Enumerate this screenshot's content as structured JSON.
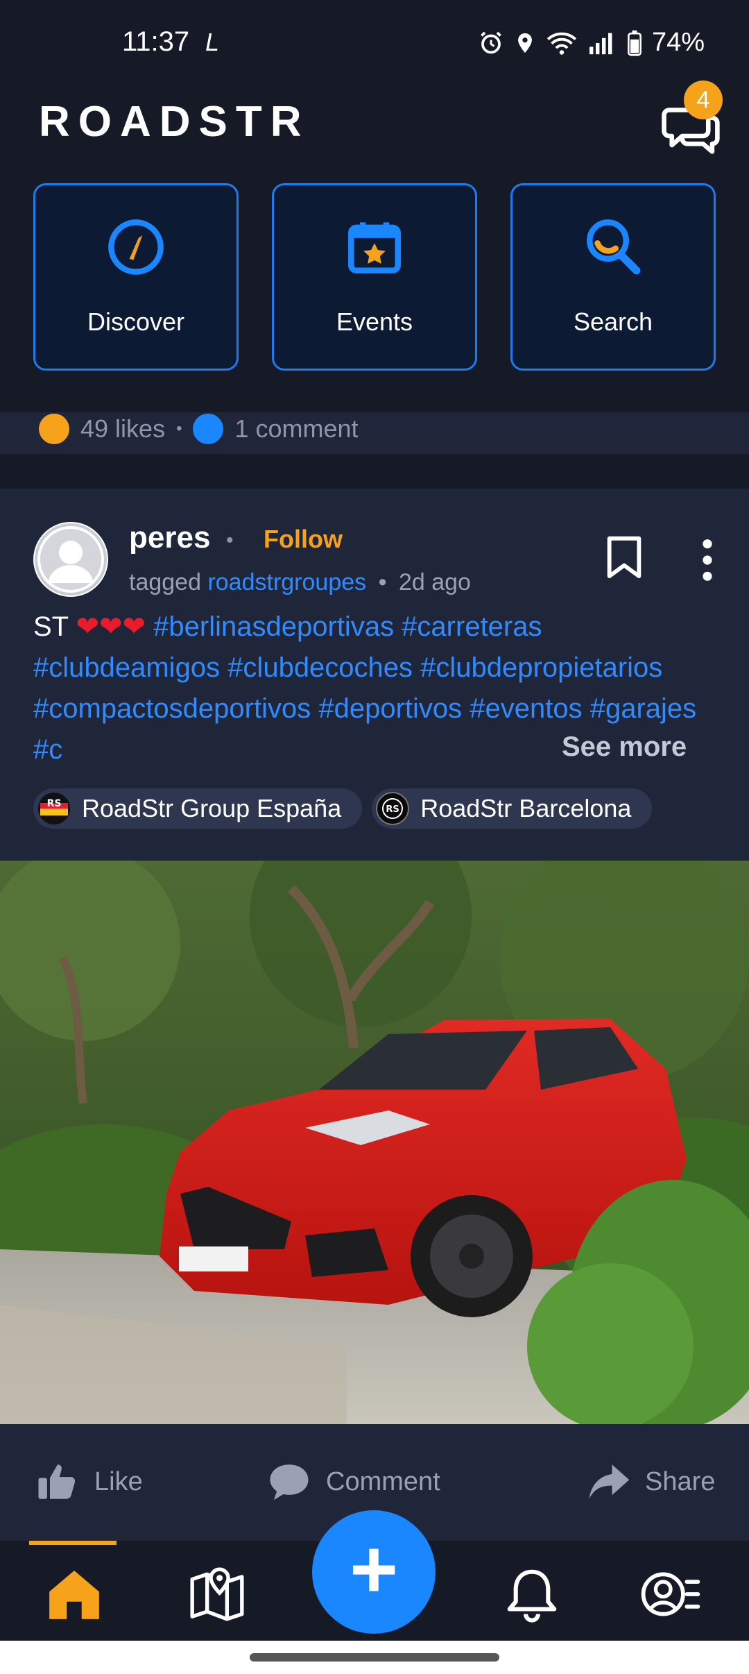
{
  "status_bar": {
    "time": "11:37",
    "l_glyph": "L",
    "battery": "74%",
    "icons": [
      "alarm-icon",
      "location-icon",
      "wifi-icon",
      "signal-icon",
      "battery-icon"
    ]
  },
  "header": {
    "brand": "ROADSTR",
    "chat_badge": "4"
  },
  "quick_actions": [
    {
      "label": "Discover",
      "icon": "compass-icon"
    },
    {
      "label": "Events",
      "icon": "calendar-star-icon"
    },
    {
      "label": "Search",
      "icon": "search-icon"
    }
  ],
  "prev_post": {
    "likes": "49 likes",
    "separator": "•",
    "comments": "1 comment"
  },
  "post": {
    "username": "peres",
    "dot": "•",
    "follow_label": "Follow",
    "tagged_prefix": "tagged",
    "tagged_group": "roadstrgroupes",
    "time_sep": "•",
    "time": "2d ago",
    "caption_lead": "ST",
    "caption_hearts": "❤❤❤",
    "hashtags": [
      "#berlinasdeportivas",
      "#carreteras",
      "#clubdeamigos",
      "#clubdecoches",
      "#clubdepropietarios",
      "#compactosdeportivos",
      "#deportivos",
      "#eventos",
      "#garajes",
      "#c"
    ],
    "see_more": "See more",
    "chips": [
      {
        "label": "RoadStr Group España"
      },
      {
        "label": "RoadStr Barcelona"
      }
    ],
    "actions": {
      "like": "Like",
      "comment": "Comment",
      "share": "Share"
    }
  },
  "bottom_nav": {
    "fab_label": "+",
    "items": [
      "home-icon",
      "map-icon",
      "bell-icon",
      "profile-menu-icon"
    ]
  },
  "colors": {
    "accent_blue": "#1a86ff",
    "accent_orange": "#f7a21b",
    "bg": "#20263a",
    "header_bg": "#161a26"
  }
}
